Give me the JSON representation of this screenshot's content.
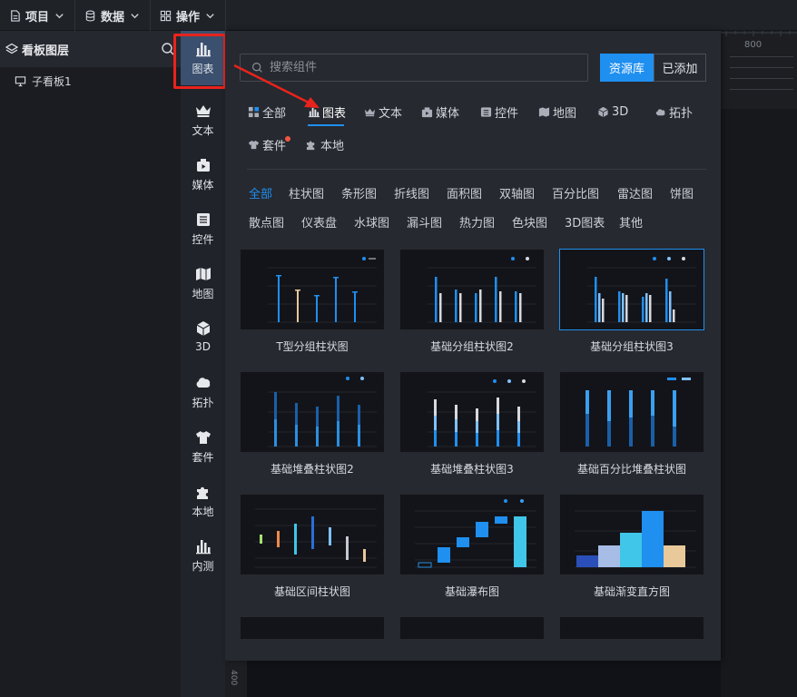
{
  "topbar": {
    "menus": [
      {
        "label": "项目",
        "icon": "file-icon"
      },
      {
        "label": "数据",
        "icon": "database-icon"
      },
      {
        "label": "操作",
        "icon": "grid-icon"
      }
    ]
  },
  "layers": {
    "title": "看板图层",
    "items": [
      {
        "label": "子看板1"
      }
    ]
  },
  "rail": {
    "items": [
      {
        "label": "图表",
        "icon": "bar-chart-icon",
        "active": true
      },
      {
        "label": "文本",
        "icon": "crown-icon"
      },
      {
        "label": "媒体",
        "icon": "media-icon"
      },
      {
        "label": "控件",
        "icon": "control-icon"
      },
      {
        "label": "地图",
        "icon": "map-icon"
      },
      {
        "label": "3D",
        "icon": "cube-icon"
      },
      {
        "label": "拓扑",
        "icon": "topology-icon"
      },
      {
        "label": "套件",
        "icon": "shirt-icon"
      },
      {
        "label": "本地",
        "icon": "puzzle-icon"
      },
      {
        "label": "内测",
        "icon": "bar-chart-icon"
      }
    ]
  },
  "canvas": {
    "ruler_top": "800",
    "ruler_left": "400"
  },
  "panel": {
    "search_placeholder": "搜索组件",
    "btn_library": "资源库",
    "btn_added": "已添加",
    "categories": [
      {
        "label": "全部",
        "icon": "all-icon"
      },
      {
        "label": "图表",
        "icon": "bar-chart-icon",
        "active": true
      },
      {
        "label": "文本",
        "icon": "crown-icon"
      },
      {
        "label": "媒体",
        "icon": "media-icon"
      },
      {
        "label": "控件",
        "icon": "control-icon"
      },
      {
        "label": "地图",
        "icon": "map-icon"
      },
      {
        "label": "3D",
        "icon": "cube-icon"
      },
      {
        "label": "拓扑",
        "icon": "topology-icon"
      },
      {
        "label": "套件",
        "icon": "shirt-icon"
      },
      {
        "label": "本地",
        "icon": "puzzle-icon"
      }
    ],
    "subcategories": [
      "全部",
      "柱状图",
      "条形图",
      "折线图",
      "面积图",
      "双轴图",
      "百分比图",
      "雷达图",
      "饼图",
      "散点图",
      "仪表盘",
      "水球图",
      "漏斗图",
      "热力图",
      "色块图",
      "3D图表",
      "其他"
    ],
    "cards": [
      {
        "name": "T型分组柱状图"
      },
      {
        "name": "基础分组柱状图2"
      },
      {
        "name": "基础分组柱状图3",
        "selected": true
      },
      {
        "name": "基础堆叠柱状图2"
      },
      {
        "name": "基础堆叠柱状图3"
      },
      {
        "name": "基础百分比堆叠柱状图"
      },
      {
        "name": "基础区间柱状图"
      },
      {
        "name": "基础瀑布图"
      },
      {
        "name": "基础渐变直方图"
      }
    ],
    "colors": {
      "accent": "#1f8ff0",
      "highlight": "#e8231d",
      "badge": "#f4553f"
    }
  }
}
